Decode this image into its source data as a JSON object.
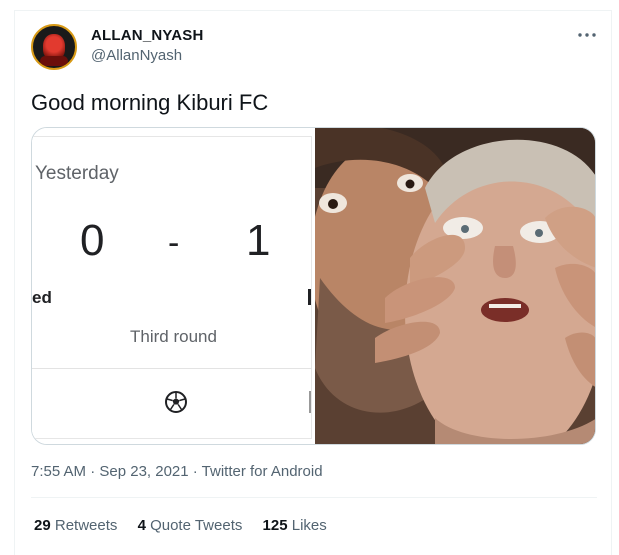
{
  "author": {
    "display_name": "ALLAN_NYASH",
    "handle": "@AllanNyash"
  },
  "tweet": {
    "text": "Good morning Kiburi FC"
  },
  "media": {
    "left_panel": {
      "day_label": "Yesterday",
      "home_score": "0",
      "separator": "-",
      "away_score": "1",
      "team_fragment": "ed",
      "round_label": "Third round",
      "sport_icon": "soccer-ball-icon"
    },
    "right_panel": {
      "description_icon": "meme-photo"
    }
  },
  "meta": {
    "timestamp": "7:55 AM · Sep 23, 2021 · Twitter for Android"
  },
  "stats": {
    "retweets_count": "29",
    "retweets_label": "Retweets",
    "quotes_count": "4",
    "quotes_label": "Quote Tweets",
    "likes_count": "125",
    "likes_label": "Likes"
  },
  "colors": {
    "avatar_ring": "#d89a16",
    "secondary_text": "#536471",
    "primary_text": "#0f1419"
  }
}
